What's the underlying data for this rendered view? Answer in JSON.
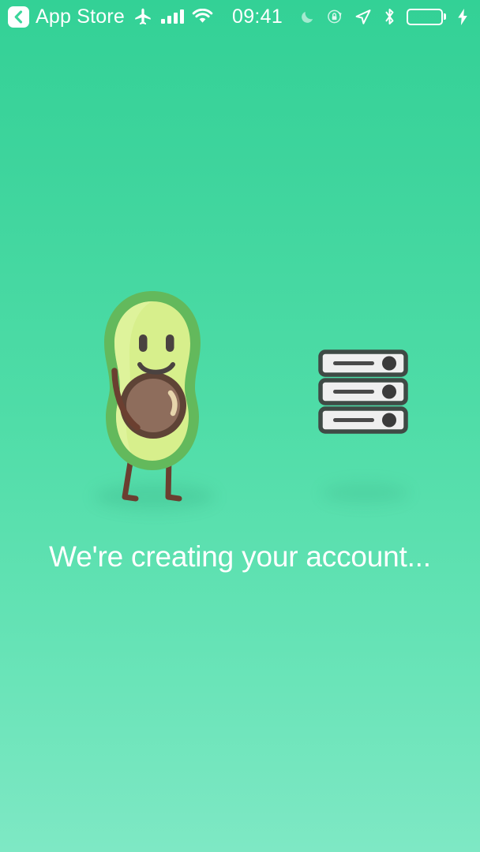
{
  "status_bar": {
    "back": {
      "icon": "chevron-left-icon",
      "label": "App Store"
    },
    "airplane_icon": "airplane-mode-icon",
    "signal_icon": "cellular-signal-icon",
    "signal_bars": 4,
    "wifi_icon": "wifi-icon",
    "time": "09:41",
    "right_icons": [
      "do-not-disturb-moon-icon",
      "rotation-lock-icon",
      "location-arrow-icon",
      "bluetooth-icon"
    ],
    "battery": {
      "icon": "battery-icon",
      "level_percent": 100,
      "charging": true,
      "charging_icon": "lightning-bolt-icon",
      "fill_color": "#6de84e"
    }
  },
  "screen": {
    "background_top_color": "#33d196",
    "background_bottom_color": "#7ee8c4",
    "caption": "We're creating your account..."
  },
  "illustration": {
    "avocado": {
      "name": "avocado-mascot",
      "rind_color": "#63b95c",
      "flesh_color": "#d7ef8c",
      "pit_outer_color": "#5e4336",
      "pit_fill_color": "#8e6d5c",
      "pit_highlight_color": "#e7d5ac",
      "limb_color": "#6b3f30",
      "face_color": "#4a4240"
    },
    "server": {
      "name": "server-stack",
      "unit_count": 3,
      "outline_color": "#3f4a45",
      "body_color": "#efefef",
      "slot_color": "#4a4a4a",
      "led_color": "#3b3b3b"
    }
  }
}
